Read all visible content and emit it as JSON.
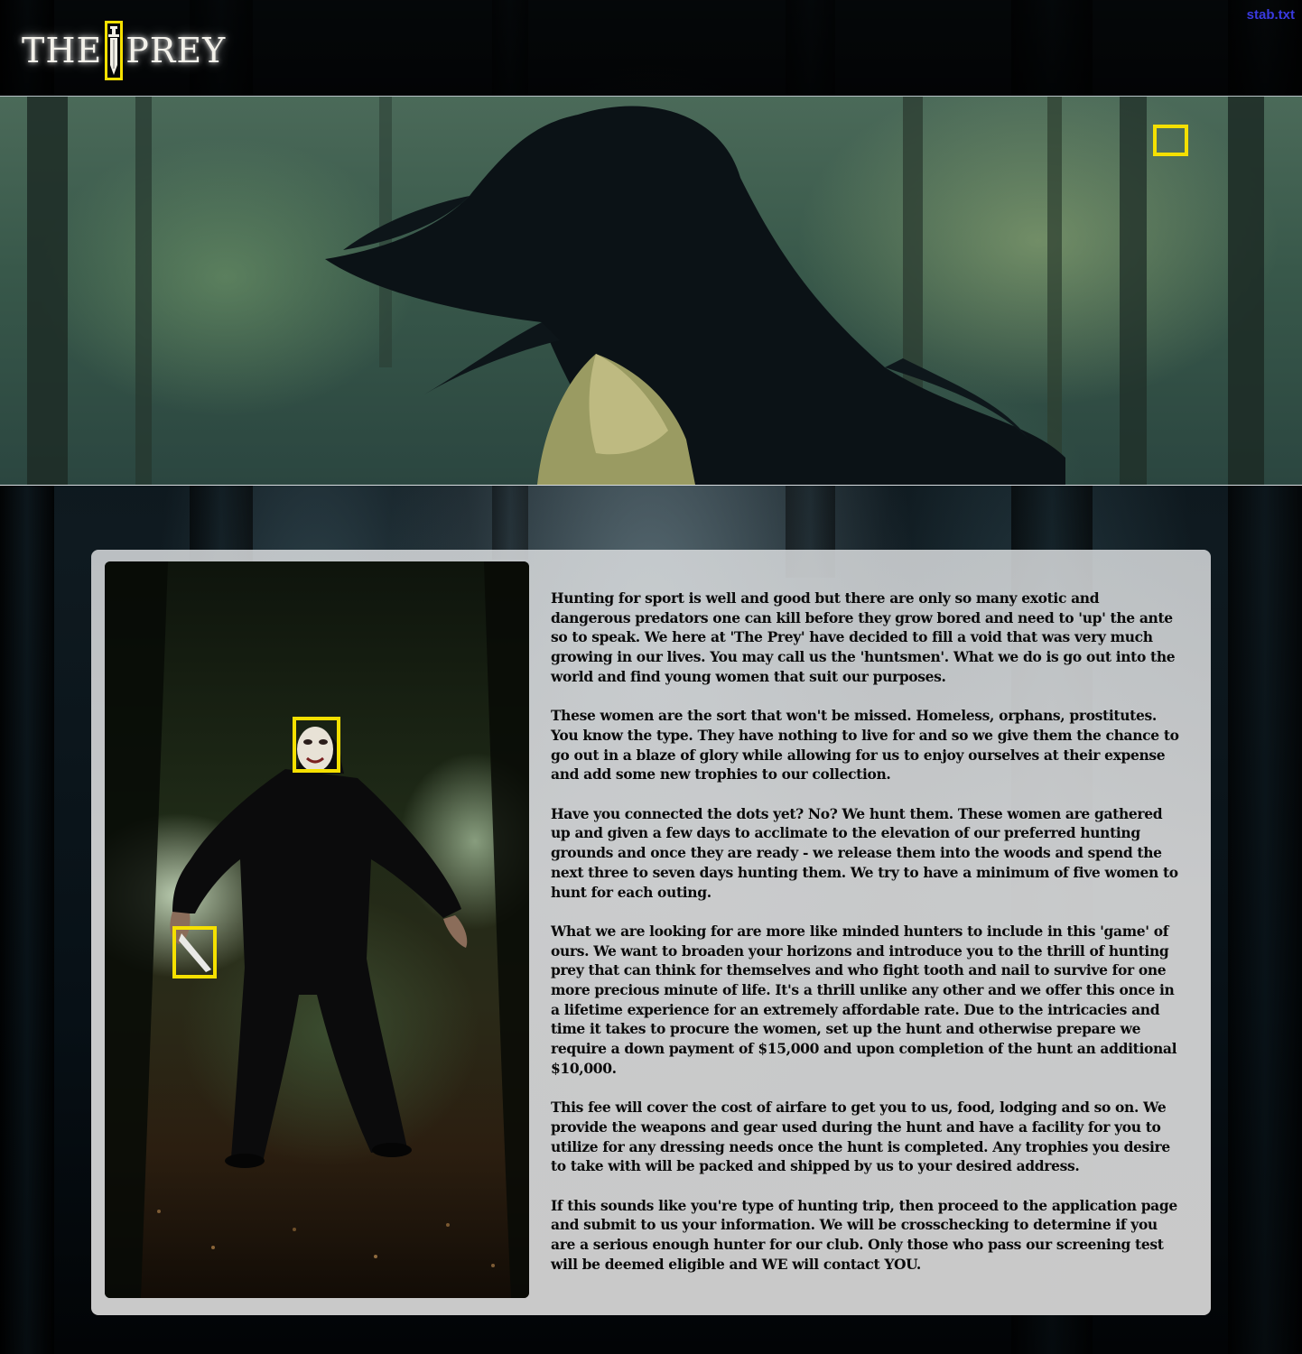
{
  "site": {
    "logo_left": "THE",
    "logo_right": "PREY",
    "file_link": "stab.txt"
  },
  "colors": {
    "highlight_box": "#f5e000",
    "link": "#3a3ae0",
    "panel": "#d2d3d4",
    "body_text": "#0b0b0b"
  },
  "icons": {
    "logo_mark": "dagger-icon"
  },
  "content": {
    "paragraphs": [
      "Hunting for sport is well and good but there are only so many exotic and dangerous predators one can kill before they grow bored and need to 'up' the ante so to speak. We here at 'The Prey' have decided to fill a void that was very much growing in our lives. You may call us the 'huntsmen'. What we do is go out into the world and find young women that suit our purposes.",
      "These women are the sort that won't be missed. Homeless, orphans, prostitutes. You know the type. They have nothing to live for and so we give them the chance to go out in a blaze of glory while allowing for us to enjoy ourselves at their expense and add some new trophies to our collection.",
      "Have you connected the dots yet? No? We hunt them. These women are gathered up and given a few days to acclimate to the elevation of our preferred hunting grounds and once they are ready - we release them into the woods and spend the next three to seven days hunting them. We try to have a minimum of five women to hunt for each outing.",
      "What we are looking for are more like minded hunters to include in this 'game' of ours. We want to broaden your horizons and introduce you to the thrill of hunting prey that can think for themselves and who fight tooth and nail to survive for one more precious minute of life. It's a thrill unlike any other and we offer this once in a lifetime experience for an extremely affordable rate. Due to the intricacies and time it takes to procure the women, set up the hunt and otherwise prepare we require a down payment of $15,000 and upon completion of the hunt an additional $10,000.",
      "This fee will cover the cost of airfare to get you to us, food, lodging and so on. We provide the weapons and gear used during the hunt and have a facility for you to utilize for any dressing needs once the hunt is completed. Any trophies you desire to take with will be packed and shipped by us to your desired address.",
      "If this sounds like you're type of hunting trip, then proceed to the application page and submit to us your information. We will be crosschecking to determine if you are a serious enough hunter for our club. Only those who pass our screening test will be deemed eligible and WE will contact YOU."
    ]
  }
}
